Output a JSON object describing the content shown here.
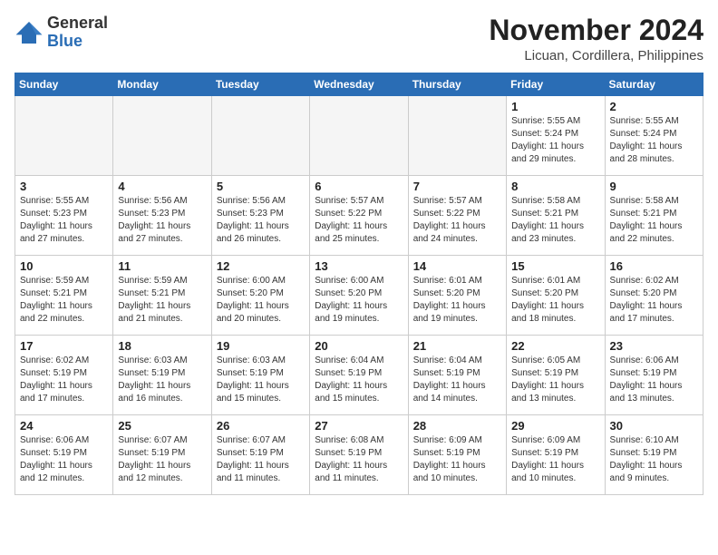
{
  "header": {
    "logo_general": "General",
    "logo_blue": "Blue",
    "month_title": "November 2024",
    "location": "Licuan, Cordillera, Philippines"
  },
  "weekdays": [
    "Sunday",
    "Monday",
    "Tuesday",
    "Wednesday",
    "Thursday",
    "Friday",
    "Saturday"
  ],
  "weeks": [
    [
      {
        "day": "",
        "empty": true
      },
      {
        "day": "",
        "empty": true
      },
      {
        "day": "",
        "empty": true
      },
      {
        "day": "",
        "empty": true
      },
      {
        "day": "",
        "empty": true
      },
      {
        "day": "1",
        "sunrise": "Sunrise: 5:55 AM",
        "sunset": "Sunset: 5:24 PM",
        "daylight": "Daylight: 11 hours and 29 minutes."
      },
      {
        "day": "2",
        "sunrise": "Sunrise: 5:55 AM",
        "sunset": "Sunset: 5:24 PM",
        "daylight": "Daylight: 11 hours and 28 minutes."
      }
    ],
    [
      {
        "day": "3",
        "sunrise": "Sunrise: 5:55 AM",
        "sunset": "Sunset: 5:23 PM",
        "daylight": "Daylight: 11 hours and 27 minutes."
      },
      {
        "day": "4",
        "sunrise": "Sunrise: 5:56 AM",
        "sunset": "Sunset: 5:23 PM",
        "daylight": "Daylight: 11 hours and 27 minutes."
      },
      {
        "day": "5",
        "sunrise": "Sunrise: 5:56 AM",
        "sunset": "Sunset: 5:23 PM",
        "daylight": "Daylight: 11 hours and 26 minutes."
      },
      {
        "day": "6",
        "sunrise": "Sunrise: 5:57 AM",
        "sunset": "Sunset: 5:22 PM",
        "daylight": "Daylight: 11 hours and 25 minutes."
      },
      {
        "day": "7",
        "sunrise": "Sunrise: 5:57 AM",
        "sunset": "Sunset: 5:22 PM",
        "daylight": "Daylight: 11 hours and 24 minutes."
      },
      {
        "day": "8",
        "sunrise": "Sunrise: 5:58 AM",
        "sunset": "Sunset: 5:21 PM",
        "daylight": "Daylight: 11 hours and 23 minutes."
      },
      {
        "day": "9",
        "sunrise": "Sunrise: 5:58 AM",
        "sunset": "Sunset: 5:21 PM",
        "daylight": "Daylight: 11 hours and 22 minutes."
      }
    ],
    [
      {
        "day": "10",
        "sunrise": "Sunrise: 5:59 AM",
        "sunset": "Sunset: 5:21 PM",
        "daylight": "Daylight: 11 hours and 22 minutes."
      },
      {
        "day": "11",
        "sunrise": "Sunrise: 5:59 AM",
        "sunset": "Sunset: 5:21 PM",
        "daylight": "Daylight: 11 hours and 21 minutes."
      },
      {
        "day": "12",
        "sunrise": "Sunrise: 6:00 AM",
        "sunset": "Sunset: 5:20 PM",
        "daylight": "Daylight: 11 hours and 20 minutes."
      },
      {
        "day": "13",
        "sunrise": "Sunrise: 6:00 AM",
        "sunset": "Sunset: 5:20 PM",
        "daylight": "Daylight: 11 hours and 19 minutes."
      },
      {
        "day": "14",
        "sunrise": "Sunrise: 6:01 AM",
        "sunset": "Sunset: 5:20 PM",
        "daylight": "Daylight: 11 hours and 19 minutes."
      },
      {
        "day": "15",
        "sunrise": "Sunrise: 6:01 AM",
        "sunset": "Sunset: 5:20 PM",
        "daylight": "Daylight: 11 hours and 18 minutes."
      },
      {
        "day": "16",
        "sunrise": "Sunrise: 6:02 AM",
        "sunset": "Sunset: 5:20 PM",
        "daylight": "Daylight: 11 hours and 17 minutes."
      }
    ],
    [
      {
        "day": "17",
        "sunrise": "Sunrise: 6:02 AM",
        "sunset": "Sunset: 5:19 PM",
        "daylight": "Daylight: 11 hours and 17 minutes."
      },
      {
        "day": "18",
        "sunrise": "Sunrise: 6:03 AM",
        "sunset": "Sunset: 5:19 PM",
        "daylight": "Daylight: 11 hours and 16 minutes."
      },
      {
        "day": "19",
        "sunrise": "Sunrise: 6:03 AM",
        "sunset": "Sunset: 5:19 PM",
        "daylight": "Daylight: 11 hours and 15 minutes."
      },
      {
        "day": "20",
        "sunrise": "Sunrise: 6:04 AM",
        "sunset": "Sunset: 5:19 PM",
        "daylight": "Daylight: 11 hours and 15 minutes."
      },
      {
        "day": "21",
        "sunrise": "Sunrise: 6:04 AM",
        "sunset": "Sunset: 5:19 PM",
        "daylight": "Daylight: 11 hours and 14 minutes."
      },
      {
        "day": "22",
        "sunrise": "Sunrise: 6:05 AM",
        "sunset": "Sunset: 5:19 PM",
        "daylight": "Daylight: 11 hours and 13 minutes."
      },
      {
        "day": "23",
        "sunrise": "Sunrise: 6:06 AM",
        "sunset": "Sunset: 5:19 PM",
        "daylight": "Daylight: 11 hours and 13 minutes."
      }
    ],
    [
      {
        "day": "24",
        "sunrise": "Sunrise: 6:06 AM",
        "sunset": "Sunset: 5:19 PM",
        "daylight": "Daylight: 11 hours and 12 minutes."
      },
      {
        "day": "25",
        "sunrise": "Sunrise: 6:07 AM",
        "sunset": "Sunset: 5:19 PM",
        "daylight": "Daylight: 11 hours and 12 minutes."
      },
      {
        "day": "26",
        "sunrise": "Sunrise: 6:07 AM",
        "sunset": "Sunset: 5:19 PM",
        "daylight": "Daylight: 11 hours and 11 minutes."
      },
      {
        "day": "27",
        "sunrise": "Sunrise: 6:08 AM",
        "sunset": "Sunset: 5:19 PM",
        "daylight": "Daylight: 11 hours and 11 minutes."
      },
      {
        "day": "28",
        "sunrise": "Sunrise: 6:09 AM",
        "sunset": "Sunset: 5:19 PM",
        "daylight": "Daylight: 11 hours and 10 minutes."
      },
      {
        "day": "29",
        "sunrise": "Sunrise: 6:09 AM",
        "sunset": "Sunset: 5:19 PM",
        "daylight": "Daylight: 11 hours and 10 minutes."
      },
      {
        "day": "30",
        "sunrise": "Sunrise: 6:10 AM",
        "sunset": "Sunset: 5:19 PM",
        "daylight": "Daylight: 11 hours and 9 minutes."
      }
    ]
  ]
}
